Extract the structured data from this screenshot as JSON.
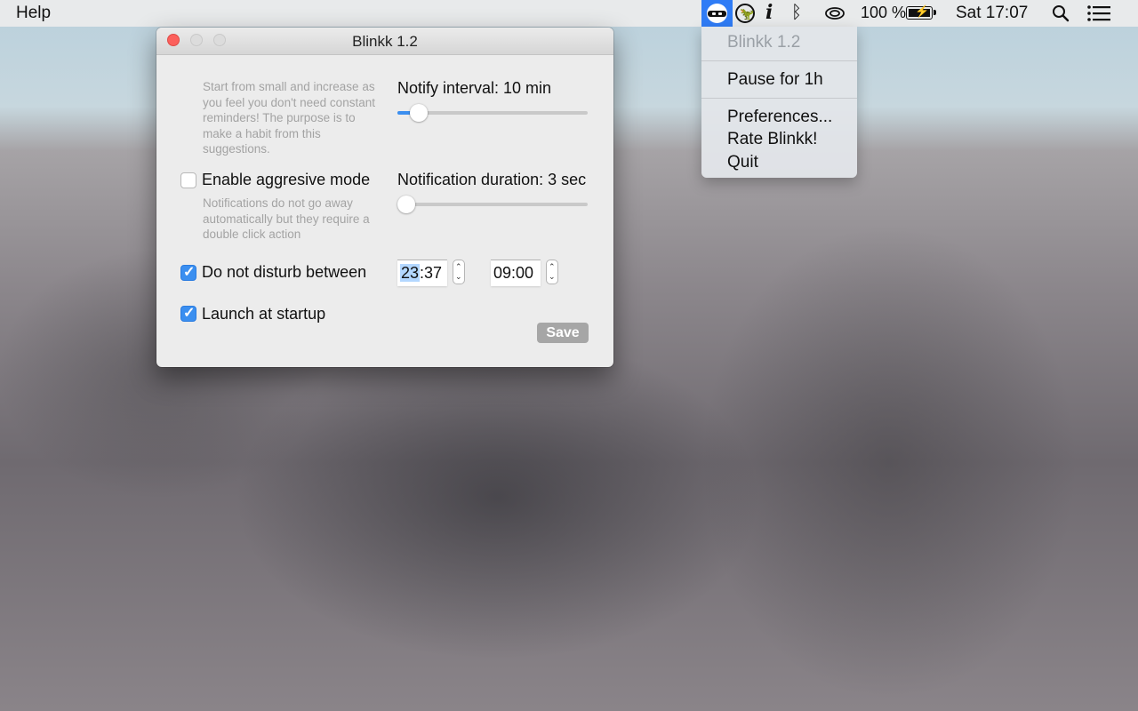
{
  "menubar": {
    "help_label": "Help",
    "battery_percent": "100 %",
    "clock": "Sat 17:07",
    "icons": [
      "blinkk-app-icon",
      "dino-icon",
      "info-icon",
      "bluetooth-icon",
      "wifi-icon",
      "battery-charging-icon",
      "search-icon",
      "notification-center-icon"
    ]
  },
  "dropdown": {
    "title": "Blinkk 1.2",
    "pause": "Pause for 1h",
    "preferences": "Preferences...",
    "rate": "Rate Blinkk!",
    "quit": "Quit"
  },
  "window": {
    "title": "Blinkk 1.2",
    "intro_hint": "Start from small and increase as you feel you don't need constant reminders! The purpose is to make a habit from this suggestions.",
    "notify_interval_label": "Notify interval: 10 min",
    "notify_interval_fraction": 0.07,
    "aggressive_label": "Enable aggresive mode",
    "aggressive_checked": false,
    "aggressive_hint": "Notifications do not go away automatically but they require a double click action",
    "duration_label": "Notification duration: 3 sec",
    "duration_fraction": 0.0,
    "dnd_label": "Do not disturb between",
    "dnd_checked": true,
    "dnd_from_hours": "23",
    "dnd_from_sep": ":",
    "dnd_from_minutes": "37",
    "dnd_to": "09:00",
    "startup_label": "Launch at startup",
    "startup_checked": true,
    "save_label": "Save"
  },
  "colors": {
    "accent": "#3b8ff0",
    "close": "#fc605c",
    "menu_highlight": "#2f7cf6"
  }
}
